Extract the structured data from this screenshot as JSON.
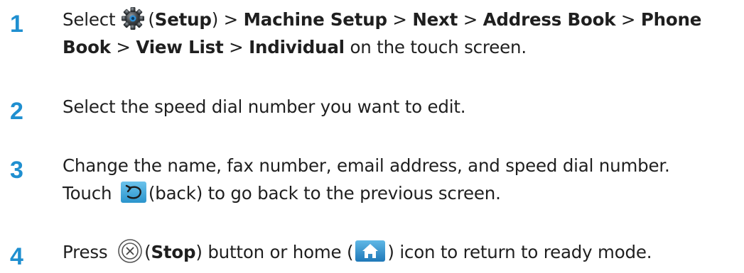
{
  "steps": [
    {
      "number": "1",
      "parts": {
        "a": "Select",
        "b": "(",
        "c": "Setup",
        "d": ") > ",
        "e": "Machine Setup",
        "f": " > ",
        "g": "Next",
        "h": " > ",
        "i": "Address Book",
        "j": " > ",
        "k": "Phone Book",
        "l": " > ",
        "m": "View List",
        "n": " > ",
        "o": "Individual",
        "p": " on the touch screen."
      },
      "icon": "gear-icon"
    },
    {
      "number": "2",
      "text": "Select the speed dial number you want to edit."
    },
    {
      "number": "3",
      "line1": "Change the name, fax number, email address, and speed dial number.",
      "line2a": "Touch ",
      "line2b": "(back) to go back to the previous screen.",
      "icon": "back-icon"
    },
    {
      "number": "4",
      "parts": {
        "a": "Press ",
        "b": "(",
        "c": "Stop",
        "d": ") button or home (",
        "e": ") icon to return to ready mode."
      },
      "icons": [
        "stop-icon",
        "home-icon"
      ]
    }
  ],
  "colors": {
    "step_number": "#1f8fd0",
    "text": "#1f1f1f",
    "back_icon_bg": "#3aa7d9",
    "home_icon_bg": "#2f8fcf"
  }
}
